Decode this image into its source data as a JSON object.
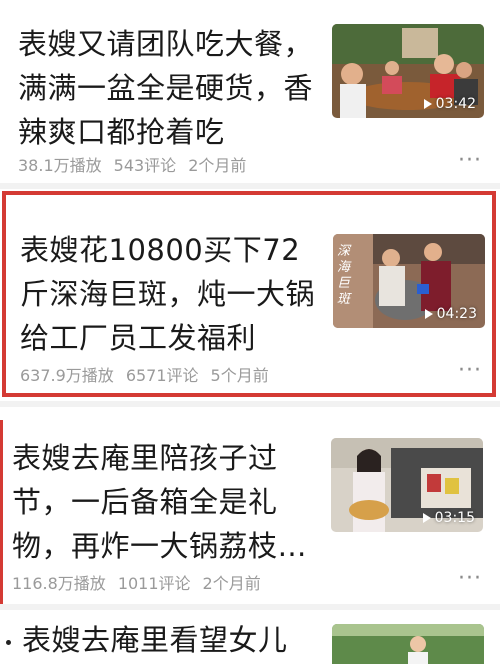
{
  "feed": [
    {
      "title_lines": [
        "表嫂又请团队吃大餐，",
        "满满一盆全是硬货，香",
        "辣爽口都抢着吃"
      ],
      "plays": "38.1万播放",
      "comments": "543评论",
      "time": "2个月前",
      "duration": "03:42"
    },
    {
      "title_lines": [
        "表嫂花10800买下72",
        "斤深海巨斑，炖一大锅",
        "给工厂员工发福利"
      ],
      "plays": "637.9万播放",
      "comments": "6571评论",
      "time": "5个月前",
      "duration": "04:23",
      "thumb_text": "深海巨斑"
    },
    {
      "title_lines": [
        "表嫂去庵里陪孩子过",
        "节，一后备箱全是礼",
        "物，再炸一大锅荔枝…"
      ],
      "plays": "116.8万播放",
      "comments": "1011评论",
      "time": "2个月前",
      "duration": "03:15"
    },
    {
      "title_lines": [
        "表嫂去庵里看望女儿"
      ]
    }
  ],
  "more_label": "···",
  "colors": {
    "highlight": "#d43a34",
    "meta": "#9a9a9a",
    "title": "#1a1a1a"
  }
}
